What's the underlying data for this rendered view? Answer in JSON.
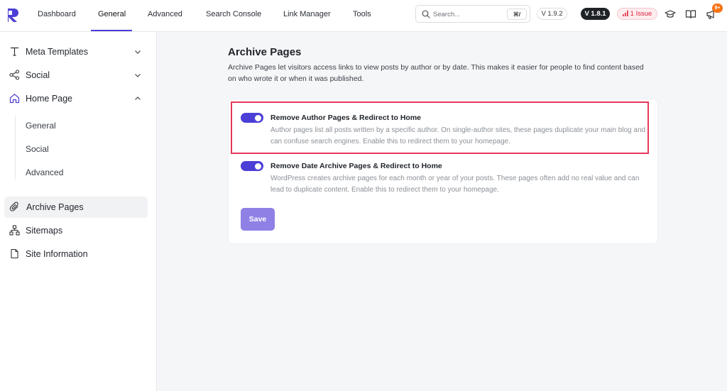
{
  "nav": {
    "tabs": [
      {
        "label": "Dashboard"
      },
      {
        "label": "General"
      },
      {
        "label": "Advanced"
      },
      {
        "label": "Search Console"
      },
      {
        "label": "Link Manager"
      },
      {
        "label": "Tools"
      }
    ],
    "active_tab": "General",
    "search": {
      "placeholder": "Search...",
      "shortcut": "⌘/"
    },
    "version_plugin": "V 1.9.2",
    "version_pro": "V 1.8.1",
    "issues_label": "1 Issue",
    "notification_count": "9+",
    "accent_color": "#4b3fd6",
    "icons": [
      "logo-icon",
      "search-icon",
      "graduation-cap-icon",
      "book-icon",
      "megaphone-icon"
    ]
  },
  "sidebar": {
    "items": [
      {
        "label": "Meta Templates",
        "icon": "text-icon",
        "expandable": true,
        "expanded": false
      },
      {
        "label": "Social",
        "icon": "share-icon",
        "expandable": true,
        "expanded": false
      },
      {
        "label": "Home Page",
        "icon": "home-icon",
        "expandable": true,
        "expanded": true
      }
    ],
    "home_page_children": [
      {
        "label": "General"
      },
      {
        "label": "Social"
      },
      {
        "label": "Advanced"
      }
    ],
    "lower_items": [
      {
        "label": "Archive Pages",
        "icon": "paperclip-icon",
        "active": true
      },
      {
        "label": "Sitemaps",
        "icon": "sitemap-icon",
        "active": false
      },
      {
        "label": "Site Information",
        "icon": "file-icon",
        "active": false
      }
    ]
  },
  "main": {
    "title": "Archive Pages",
    "description": "Archive Pages let visitors access links to view posts by author or by date. This makes it easier for people to find content based on who wrote it or when it was published.",
    "options": [
      {
        "title": "Remove Author Pages & Redirect to Home",
        "description": "Author pages list all posts written by a specific author. On single-author sites, these pages duplicate your main blog and can confuse search engines. Enable this to redirect them to your homepage.",
        "enabled": true,
        "highlighted": true
      },
      {
        "title": "Remove Date Archive Pages & Redirect to Home",
        "description": "WordPress creates archive pages for each month or year of your posts. These pages often add no real value and can lead to duplicate content. Enable this to redirect them to your homepage.",
        "enabled": true,
        "highlighted": false
      }
    ],
    "save_label": "Save",
    "highlight_color": "#e6375a"
  }
}
